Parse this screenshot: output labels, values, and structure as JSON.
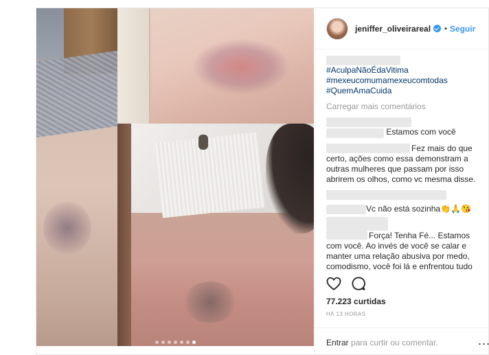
{
  "post": {
    "carousel": {
      "slide_count": 7,
      "active_slide": 7
    },
    "header": {
      "username": "jeniffer_oliveirareal",
      "separator": "•",
      "follow_label": "Seguir"
    },
    "caption": {
      "hashtags": [
        "#AculpaNãoÉdaVitima",
        "#mexeucomumamexeucomtodas",
        "#QuemAmaCuida"
      ]
    },
    "load_more_label": "Carregar mais comentários",
    "comments": [
      {
        "text": "Estamos com você"
      },
      {
        "text": "Fez mais do que certo, ações como essa demonstram a outras mulheres que passam por isso abrirem os olhos, como vc mesma disse."
      },
      {
        "text": "Vc não está sozinha👏🙏😘"
      },
      {
        "text": "Força! Tenha Fé... Estamos com você. Ao invés de você se calar e manter uma relação abusiva por medo, comodismo, você foi lá e enfrentou tudo"
      }
    ],
    "likes_label": "77.223 curtidas",
    "time_label": "HÁ 13 HORAS",
    "footer": {
      "enter_label": "Entrar",
      "rest_label": " para curtir ou comentar.",
      "more_label": "..."
    },
    "colors": {
      "link": "#3897f0",
      "hashtag": "#003569",
      "muted": "#999999"
    }
  }
}
